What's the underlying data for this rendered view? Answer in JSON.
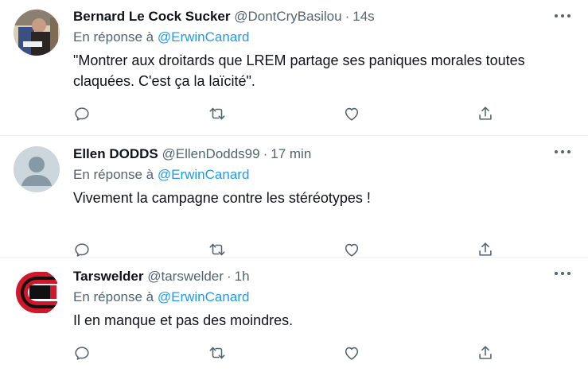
{
  "colors": {
    "link": "#1d9bf0",
    "secondary": "#536471",
    "text": "#0f1419"
  },
  "tweets": [
    {
      "name": "Bernard Le Cock Sucker",
      "handle": "@DontCryBasilou",
      "time": "14s",
      "reply_prefix": "En réponse à",
      "reply_to": "@ErwinCanard",
      "text_lines": [
        "\"Montrer aux droitards que LREM partage ses paniques morales toutes",
        "claquées. C'est ça la laïcité\"."
      ],
      "avatar": "user-photo-avatar"
    },
    {
      "name": "Ellen DODDS",
      "handle": "@EllenDodds99",
      "time": "17 min",
      "reply_prefix": "En réponse à",
      "reply_to": "@ErwinCanard",
      "text_lines": [
        "Vivement la campagne contre les stéréotypes !"
      ],
      "avatar": "default-user-avatar"
    },
    {
      "name": "Tarswelder",
      "handle": "@tarswelder",
      "time": "1h",
      "reply_prefix": "En réponse à",
      "reply_to": "@ErwinCanard",
      "text_lines": [
        "Il en manque et pas des moindres."
      ],
      "avatar": "logo-avatar"
    }
  ],
  "separator": "·",
  "action_icons": [
    "reply-icon",
    "retweet-icon",
    "like-icon",
    "share-icon"
  ]
}
